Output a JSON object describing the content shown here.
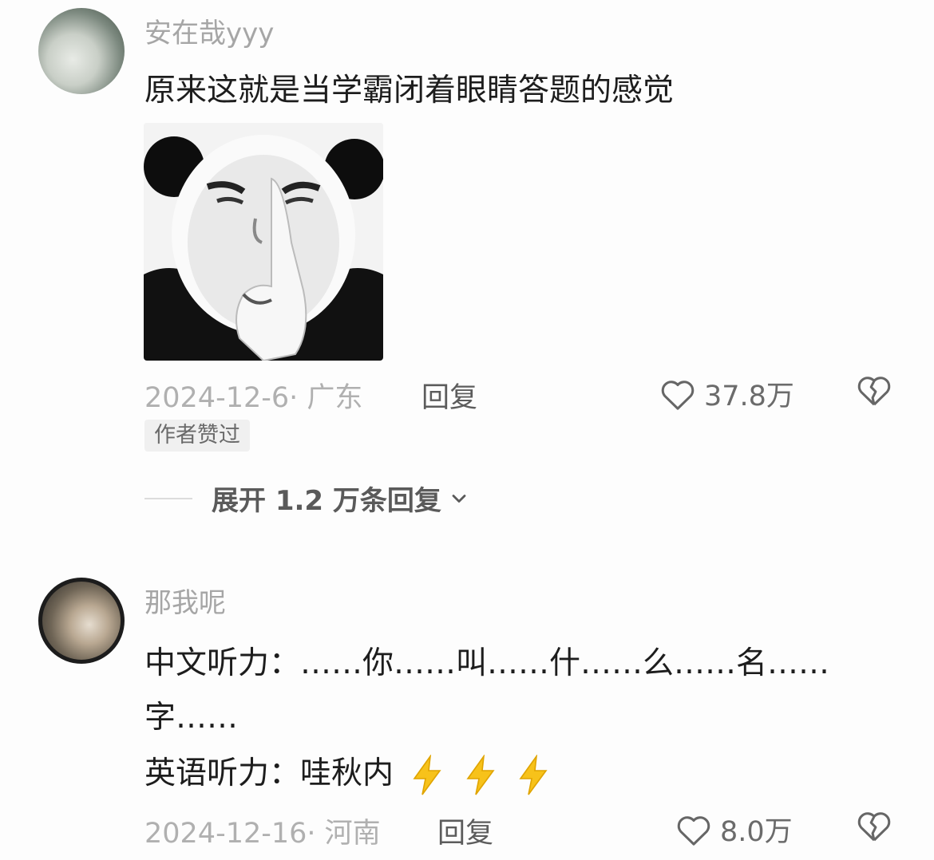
{
  "comments": [
    {
      "username": "安在哉yyy",
      "text": "原来这就是当学霸闭着眼睛答题的感觉",
      "date_location": "2024-12-6· 广东",
      "reply_label": "回复",
      "likes": "37.8万",
      "badge": "作者赞过",
      "expand_label": "展开 1.2 万条回复"
    },
    {
      "username": "那我呢",
      "lines": [
        "中文听力：……你……叫……什……么……名……",
        "字……",
        "英语听力：哇秋内"
      ],
      "date_location": "2024-12-16· 河南",
      "reply_label": "回复",
      "likes": "8.0万"
    }
  ],
  "icons": {
    "like": "heart-outline-icon",
    "dislike": "broken-heart-icon",
    "expand": "chevron-down-icon",
    "emoji": "lightning-emoji-icon"
  },
  "colors": {
    "text": "#1d1d1d",
    "meta": "#b0b0b0",
    "bolt": "#f7c21a"
  }
}
